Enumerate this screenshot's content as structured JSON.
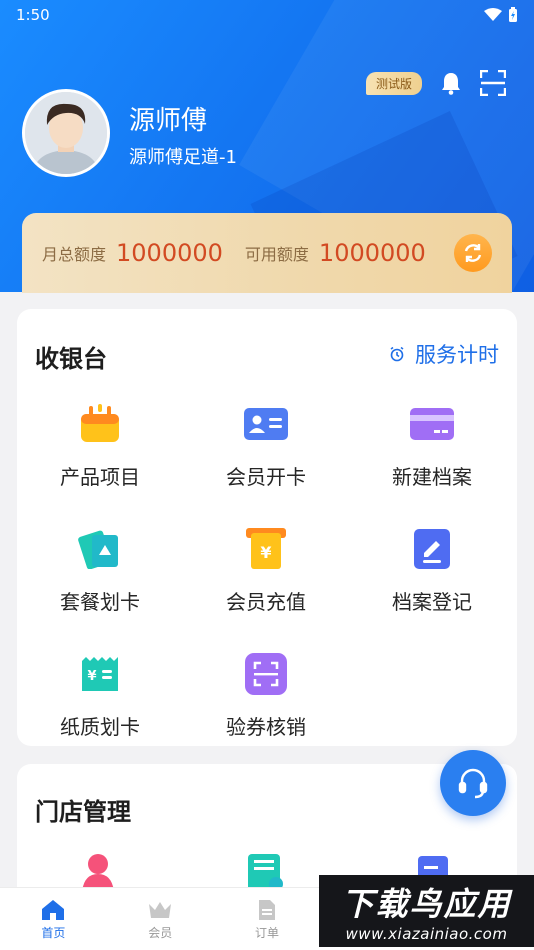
{
  "status": {
    "time": "1:50",
    "icons": [
      "wifi-icon",
      "battery-icon"
    ]
  },
  "header": {
    "badge": "测试版",
    "name": "源师傅",
    "store": "源师傅足道-1"
  },
  "quota": {
    "monthly_label": "月总额度",
    "monthly_value": "1000000",
    "available_label": "可用额度",
    "available_value": "1000000"
  },
  "cashier": {
    "title": "收银台",
    "timer_label": "服务计时",
    "items": [
      {
        "label": "产品项目",
        "icon": "product-basket-icon"
      },
      {
        "label": "会员开卡",
        "icon": "member-card-icon"
      },
      {
        "label": "新建档案",
        "icon": "new-file-card-icon"
      },
      {
        "label": "套餐划卡",
        "icon": "package-card-icon"
      },
      {
        "label": "会员充值",
        "icon": "recharge-icon"
      },
      {
        "label": "档案登记",
        "icon": "register-edit-icon"
      },
      {
        "label": "纸质划卡",
        "icon": "paper-ticket-icon"
      },
      {
        "label": "验券核销",
        "icon": "scan-voucher-icon"
      }
    ]
  },
  "store_mgmt": {
    "title": "门店管理",
    "items": [
      {
        "icon": "staff-icon"
      },
      {
        "icon": "report-icon"
      },
      {
        "icon": "device-icon"
      }
    ]
  },
  "tabs": [
    {
      "label": "首页",
      "icon": "home-icon",
      "active": true
    },
    {
      "label": "会员",
      "icon": "crown-icon",
      "active": false
    },
    {
      "label": "订单",
      "icon": "order-icon",
      "active": false
    },
    {
      "label": "",
      "icon": "",
      "active": false
    },
    {
      "label": "",
      "icon": "",
      "active": false
    }
  ],
  "watermark": {
    "title": "下载鸟应用",
    "url": "www.xiazainiao.com"
  },
  "colors": {
    "primary": "#1f6fe8",
    "quota_value": "#d24a22",
    "quota_label": "#8c6c44"
  }
}
